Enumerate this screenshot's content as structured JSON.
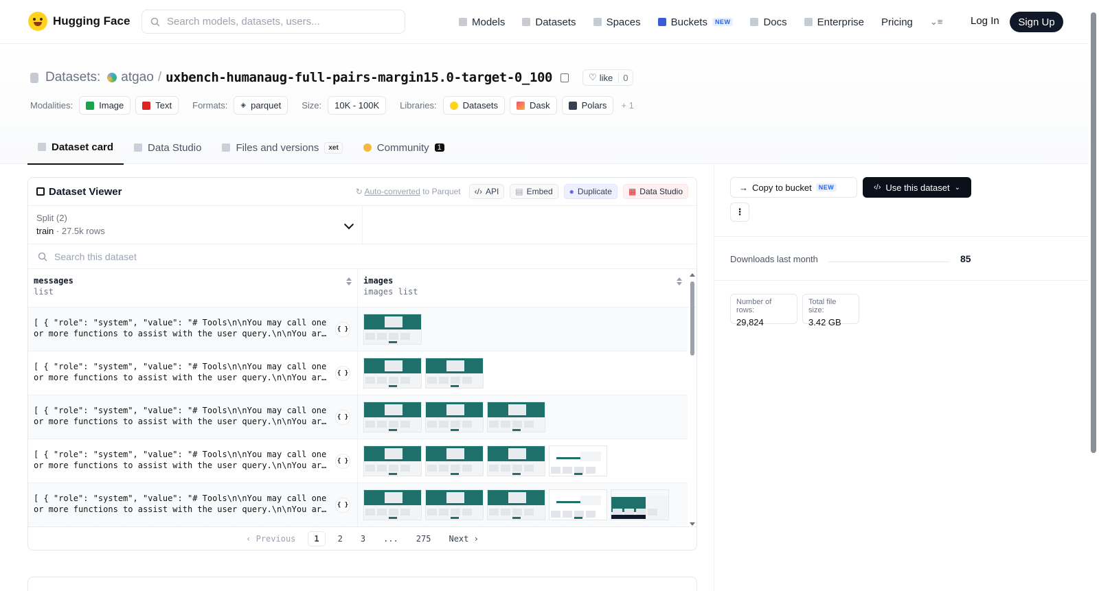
{
  "nav": {
    "brand": "Hugging Face",
    "search_placeholder": "Search models, datasets, users...",
    "links": [
      "Models",
      "Datasets",
      "Spaces",
      "Buckets",
      "Docs",
      "Enterprise",
      "Pricing"
    ],
    "buckets_badge": "NEW",
    "login": "Log In",
    "signup": "Sign Up"
  },
  "header": {
    "section_label": "Datasets:",
    "owner": "atgao",
    "separator": "/",
    "repo": "uxbench-humanaug-full-pairs-margin15.0-target-0_100",
    "like_label": "like",
    "like_count": "0",
    "modalities_label": "Modalities:",
    "modalities": [
      "Image",
      "Text"
    ],
    "formats_label": "Formats:",
    "format": "parquet",
    "size_label": "Size:",
    "size": "10K - 100K",
    "libraries_label": "Libraries:",
    "libraries": [
      "Datasets",
      "Dask",
      "Polars"
    ],
    "more_libraries": "+ 1"
  },
  "tabs": {
    "dataset_card": "Dataset card",
    "data_studio": "Data Studio",
    "files": "Files and versions",
    "xet_badge": "xet",
    "community": "Community",
    "community_count": "1"
  },
  "viewer": {
    "title": "Dataset Viewer",
    "auto_link": "Auto-converted",
    "auto_rest": " to Parquet",
    "api": "API",
    "embed": "Embed",
    "duplicate": "Duplicate",
    "data_studio": "Data Studio",
    "split_label": "Split (2)",
    "split_name": "train",
    "split_dot": " · ",
    "split_rows": "27.5k rows",
    "search_placeholder": "Search this dataset",
    "columns": [
      {
        "name": "messages",
        "type": "list"
      },
      {
        "name": "images",
        "type": "images list"
      }
    ],
    "row_text": "[ { \"role\": \"system\", \"value\": \"# Tools\\n\\nYou may call one\nor more functions to assist with the user query.\\n\\nYou are…",
    "json_btn": "{ }",
    "image_counts": [
      1,
      2,
      3,
      4,
      5
    ],
    "pager": {
      "prev": "‹ Previous",
      "pages": [
        "1",
        "2",
        "3",
        "...",
        "275"
      ],
      "next": "Next ›"
    }
  },
  "sidebar": {
    "copy_bucket": "Copy to bucket",
    "copy_badge": "NEW",
    "use_dataset": "Use this dataset",
    "kebab": "⋮",
    "downloads_label": "Downloads last month",
    "downloads_value": "85",
    "rows_label": "Number of rows:",
    "rows_value": "29,824",
    "filesize_label": "Total file size:",
    "filesize_value": "3.42 GB"
  }
}
